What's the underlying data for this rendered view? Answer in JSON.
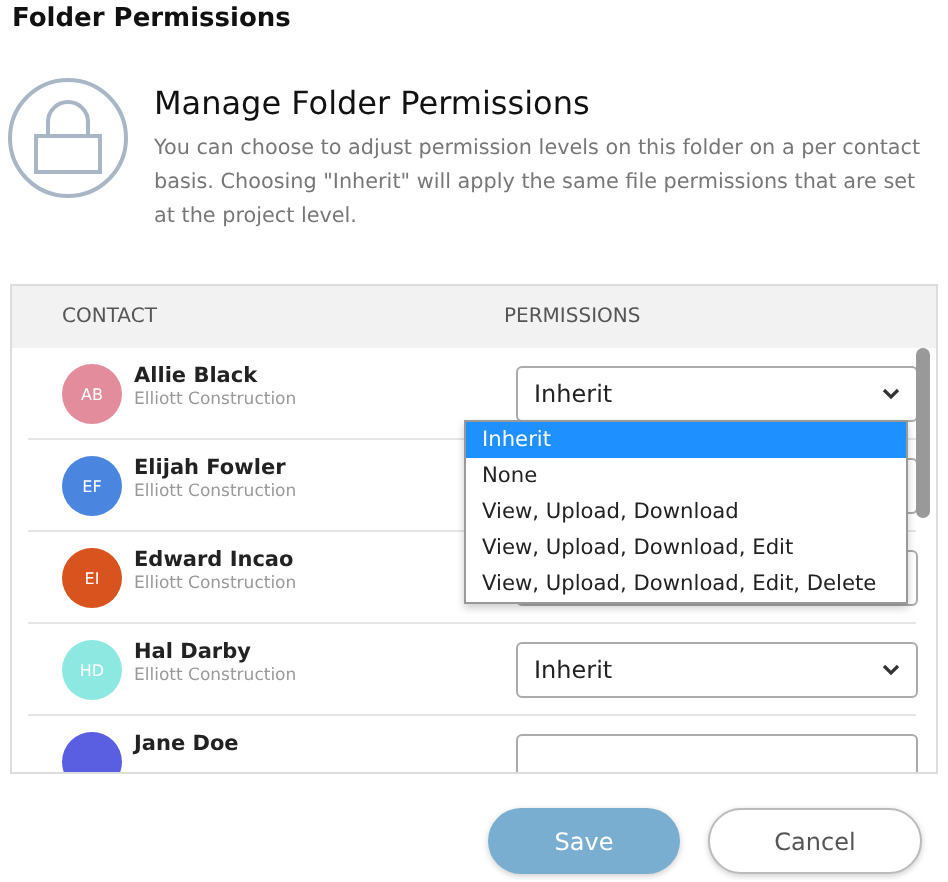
{
  "dialog": {
    "title": "Folder Permissions"
  },
  "intro": {
    "heading": "Manage Folder Permissions",
    "description": "You can choose to adjust permission levels on this folder on a per contact basis. Choosing \"Inherit\" will apply the same file permissions that are set at the project level."
  },
  "table": {
    "columns": [
      "CONTACT",
      "PERMISSIONS"
    ],
    "rows": [
      {
        "initials": "AB",
        "name": "Allie Black",
        "company": "Elliott Construction",
        "color": "#e38c9c",
        "permission": "Inherit"
      },
      {
        "initials": "EF",
        "name": "Elijah Fowler",
        "company": "Elliott Construction",
        "color": "#4a86e0"
      },
      {
        "initials": "EI",
        "name": "Edward Incao",
        "company": "Elliott Construction",
        "color": "#d9531e"
      },
      {
        "initials": "HD",
        "name": "Hal Darby",
        "company": "Elliott Construction",
        "color": "#8ee8e2",
        "permission": "Inherit"
      },
      {
        "name": "Jane Doe",
        "color": "#5a5ee0"
      }
    ]
  },
  "dropdown": {
    "options": [
      {
        "label": "Inherit",
        "selected": true
      },
      {
        "label": "None",
        "selected": false
      },
      {
        "label": "View, Upload, Download",
        "selected": false
      },
      {
        "label": "View, Upload, Download, Edit",
        "selected": false
      },
      {
        "label": "View, Upload, Download, Edit, Delete",
        "selected": false
      }
    ]
  },
  "buttons": [
    {
      "label": "Save",
      "kind": "primary"
    },
    {
      "label": "Cancel",
      "kind": "secondary"
    }
  ]
}
